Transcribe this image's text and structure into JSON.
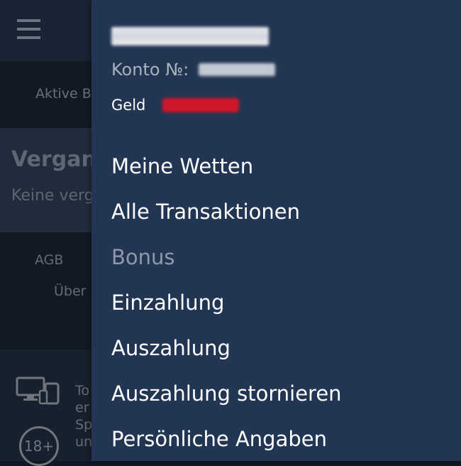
{
  "background": {
    "tab_label": "Aktive B",
    "section_title": "Vergan",
    "section_subtitle": "Keine verg",
    "footer_links": [
      "AGB",
      "Über"
    ],
    "footer_text_lines": [
      "To",
      "er",
      "Sp",
      "un"
    ],
    "age_badge": "18+"
  },
  "drawer": {
    "account_name": "████████",
    "konto_label": "Konto №:",
    "konto_value": "██████",
    "geld_label": "Geld",
    "geld_value": "██████",
    "menu": [
      {
        "label": "Meine Wetten",
        "enabled": true
      },
      {
        "label": "Alle Transaktionen",
        "enabled": true
      },
      {
        "label": "Bonus",
        "enabled": false
      },
      {
        "label": "Einzahlung",
        "enabled": true
      },
      {
        "label": "Auszahlung",
        "enabled": true
      },
      {
        "label": "Auszahlung stornieren",
        "enabled": true
      },
      {
        "label": "Persönliche Angaben",
        "enabled": true
      }
    ]
  },
  "colors": {
    "drawer_bg": "#223552",
    "menu_text": "#ffffff",
    "menu_disabled": "#8f99a8",
    "balance_redaction": "#d0172a"
  },
  "icons": [
    "hamburger-menu-icon",
    "devices-icon",
    "age-restriction-icon"
  ]
}
